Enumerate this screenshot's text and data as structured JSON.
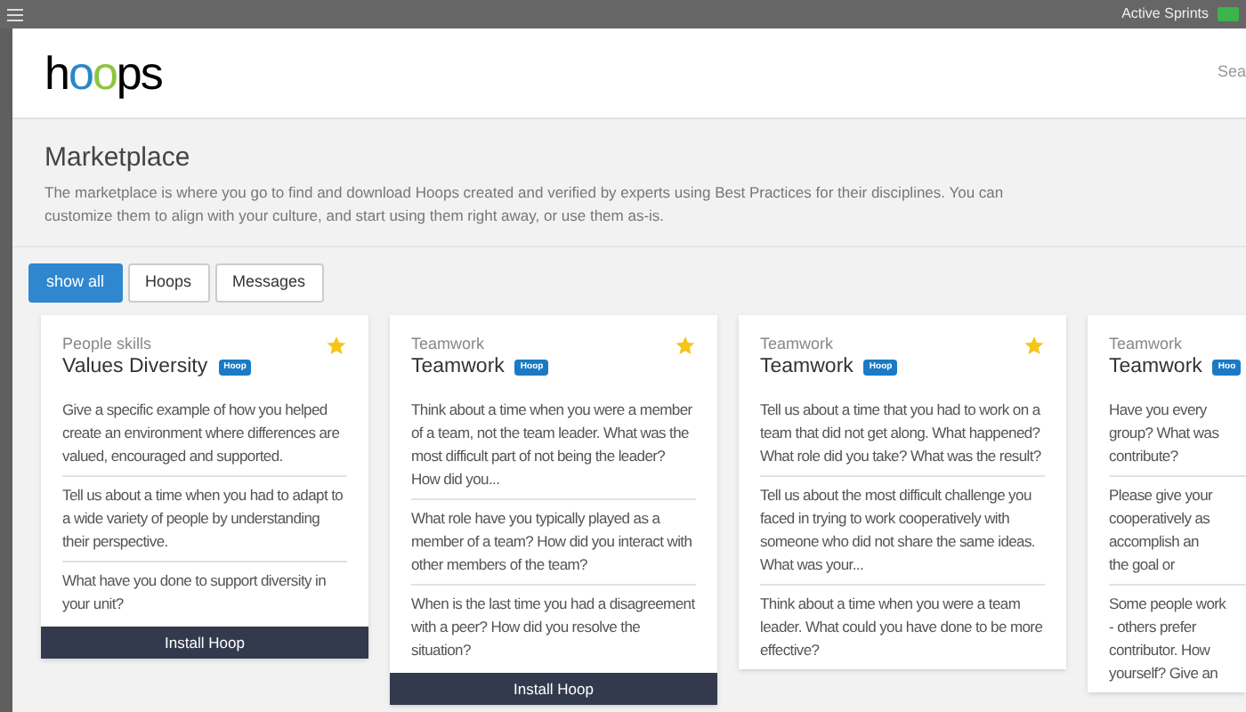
{
  "top_bar": {
    "label": "Active Sprints"
  },
  "header": {
    "logo": "hoops",
    "search": {
      "placeholder": "Sea"
    }
  },
  "page": {
    "title": "Marketplace",
    "description": "The marketplace is where you go to find and download Hoops created and verified by experts using Best Practices for their disciplines. You can customize them to align with your culture, and start using them right away, or use them as-is."
  },
  "filters": [
    {
      "label": "show all",
      "selected": true
    },
    {
      "label": "Hoops",
      "selected": false
    },
    {
      "label": "Messages",
      "selected": false
    }
  ],
  "cards": [
    {
      "kind": "full",
      "category": "People skills",
      "title": "Values Diversity",
      "badge": "Hoop",
      "starred": true,
      "questions": [
        "Give a specific example of how you helped create an environment where differences are valued, encouraged and supported.",
        "Tell us about a time when you had to adapt to a wide variety of people by understanding their perspective.",
        "What have you done to support diversity in your unit?"
      ],
      "button": "Install Hoop"
    },
    {
      "kind": "full",
      "category": "Teamwork",
      "title": "Teamwork",
      "badge": "Hoop",
      "starred": true,
      "questions": [
        "Think about a time when you were a member of a team, not the team leader. What was the most difficult part of not being the leader? How did you...",
        "What role have you typically played as a member of a team? How did you interact with other members of the team?",
        "When is the last time you had a disagreement with a peer? How did you resolve the situation?"
      ],
      "button": "Install Hoop"
    },
    {
      "kind": "full",
      "category": "Teamwork",
      "title": "Teamwork",
      "badge": "Hoop",
      "starred": true,
      "questions": [
        "Tell us about a time that you had to work on a team that did not get along. What happened? What role did you take? What was the result?",
        "Tell us about the most difficult challenge you faced in trying to work cooperatively with someone who did not share the same ideas. What was your...",
        "Think about a time when you were a team leader. What could you have done to be more effective?"
      ]
    },
    {
      "kind": "clipped",
      "category": "Teamwork",
      "title": "Teamwork",
      "badge": "Hoo",
      "questions": [
        [
          "Have you every",
          "group? What was",
          "contribute?"
        ],
        [
          "Please give your",
          "cooperatively as",
          "accomplish an",
          "the goal or"
        ],
        [
          "Some people work",
          "- others prefer",
          "contributor. How",
          "yourself? Give an"
        ]
      ]
    }
  ]
}
